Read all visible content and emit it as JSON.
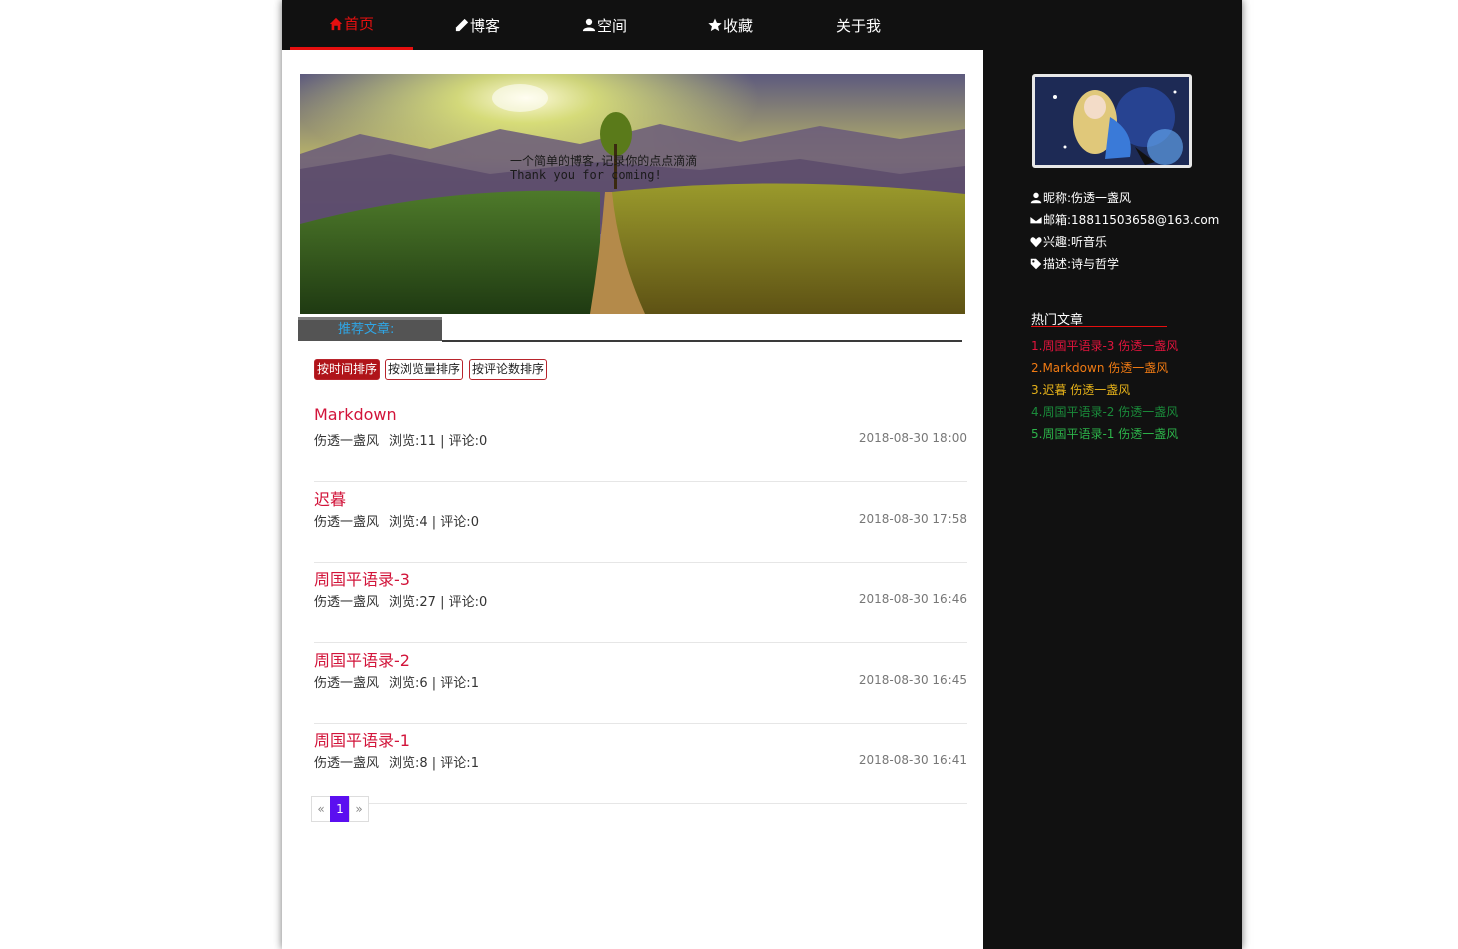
{
  "nav": {
    "items": [
      {
        "label": "首页",
        "icon": "home-icon",
        "active": true
      },
      {
        "label": "博客",
        "icon": "pencil-icon",
        "active": false
      },
      {
        "label": "空间",
        "icon": "user-icon",
        "active": false
      },
      {
        "label": "收藏",
        "icon": "star-icon",
        "active": false
      },
      {
        "label": "关于我",
        "icon": "",
        "active": false
      }
    ]
  },
  "banner": {
    "line1": "一个简单的博客,记录你的点点滴滴",
    "line2": "Thank you for coming!"
  },
  "recommend": {
    "label": "推荐文章:"
  },
  "sort": {
    "by_time": "按时间排序",
    "by_views": "按浏览量排序",
    "by_comments": "按评论数排序"
  },
  "articles": [
    {
      "title": "Markdown",
      "author": "伤透一盏风",
      "stats": "浏览:11 | 评论:0",
      "date": "2018-08-30 18:00"
    },
    {
      "title": "迟暮",
      "author": "伤透一盏风",
      "stats": "浏览:4 | 评论:0",
      "date": "2018-08-30 17:58"
    },
    {
      "title": "周国平语录-3",
      "author": "伤透一盏风",
      "stats": "浏览:27 | 评论:0",
      "date": "2018-08-30 16:46"
    },
    {
      "title": "周国平语录-2",
      "author": "伤透一盏风",
      "stats": "浏览:6 | 评论:1",
      "date": "2018-08-30 16:45"
    },
    {
      "title": "周国平语录-1",
      "author": "伤透一盏风",
      "stats": "浏览:8 | 评论:1",
      "date": "2018-08-30 16:41"
    }
  ],
  "pager": {
    "prev": "«",
    "current": "1",
    "next": "»"
  },
  "profile": {
    "nickname": "昵称:伤透一盏风",
    "email": "邮箱:18811503658@163.com",
    "hobby": "兴趣:听音乐",
    "description": "描述:诗与哲学"
  },
  "hot": {
    "title": "热门文章",
    "items": [
      {
        "label": "1.周国平语录-3 伤透一盏风",
        "color": "#e0143c"
      },
      {
        "label": "2.Markdown 伤透一盏风",
        "color": "#ef7a13"
      },
      {
        "label": "3.迟暮 伤透一盏风",
        "color": "#e6b21a"
      },
      {
        "label": "4.周国平语录-2 伤透一盏风",
        "color": "#1a8a3a"
      },
      {
        "label": "5.周国平语录-1 伤透一盏风",
        "color": "#2db34a"
      }
    ]
  },
  "colors": {
    "accent": "#e60f0f",
    "title_red": "#d2143a",
    "pager_active": "#5b0ff0",
    "tab_text": "#2fa6e6"
  }
}
